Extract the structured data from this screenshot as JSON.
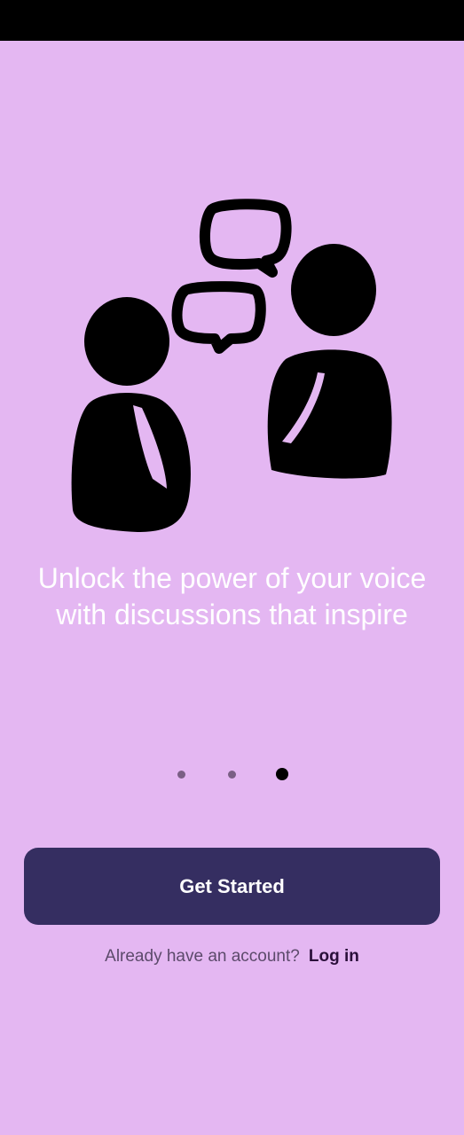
{
  "onboarding": {
    "headline": "Unlock the power of your voice with discussions that inspire",
    "illustration_icon": "two-people-talking-icon",
    "pager": {
      "total": 3,
      "active_index": 3
    },
    "get_started_label": "Get Started",
    "login_prompt": "Already have an account?",
    "login_link": "Log in"
  },
  "colors": {
    "background": "#e4b7f2",
    "button": "#352e61",
    "button_text": "#ffffff",
    "headline": "#ffffff",
    "dot_inactive": "#7a5f85",
    "dot_active": "#000000"
  }
}
